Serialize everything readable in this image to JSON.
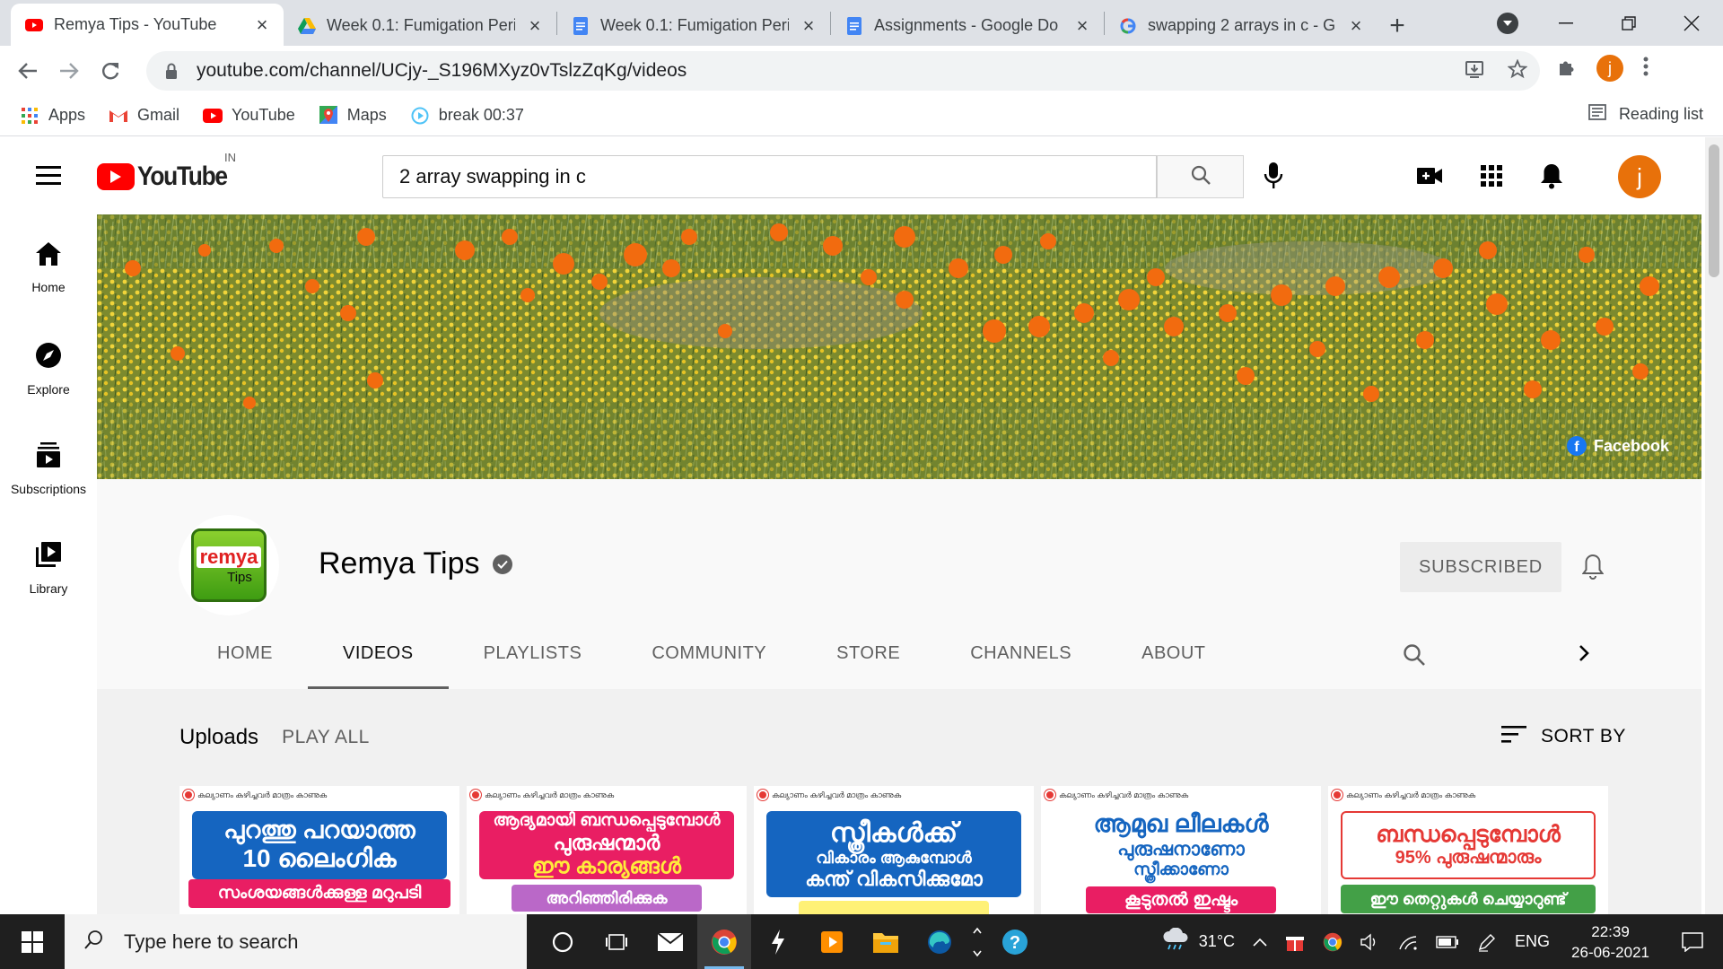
{
  "browser": {
    "tabs": [
      {
        "title": "Remya Tips - YouTube",
        "favicon": "youtube-icon",
        "active": true
      },
      {
        "title": "Week 0.1: Fumigation Peri",
        "favicon": "google-drive-icon",
        "active": false
      },
      {
        "title": "Week 0.1: Fumigation Peri",
        "favicon": "google-docs-icon",
        "active": false
      },
      {
        "title": "Assignments - Google Do",
        "favicon": "google-docs-icon",
        "active": false
      },
      {
        "title": "swapping 2 arrays in c - G",
        "favicon": "google-icon",
        "active": false
      }
    ],
    "url": "youtube.com/channel/UCjy-_S196MXyz0vTslzZqKg/videos",
    "profile_initial": "j",
    "bookmarks": [
      {
        "label": "Apps",
        "icon": "apps-grid-icon"
      },
      {
        "label": "Gmail",
        "icon": "gmail-icon"
      },
      {
        "label": "YouTube",
        "icon": "youtube-icon"
      },
      {
        "label": "Maps",
        "icon": "maps-icon"
      },
      {
        "label": "break 00:37",
        "icon": "timer-icon"
      }
    ],
    "reading_list": "Reading list"
  },
  "youtube": {
    "country_code": "IN",
    "search_query": "2 array swapping in c",
    "user_initial": "j",
    "guide": [
      {
        "label": "Home",
        "icon": "home-icon"
      },
      {
        "label": "Explore",
        "icon": "compass-icon"
      },
      {
        "label": "Subscriptions",
        "icon": "subscriptions-icon"
      },
      {
        "label": "Library",
        "icon": "library-icon"
      }
    ],
    "banner_link": "Facebook",
    "channel": {
      "name": "Remya Tips",
      "logo_line1": "remya",
      "logo_line2": "Tips",
      "subscribe_label": "SUBSCRIBED",
      "tabs": [
        "HOME",
        "VIDEOS",
        "PLAYLISTS",
        "COMMUNITY",
        "STORE",
        "CHANNELS",
        "ABOUT"
      ],
      "selected_tab": "VIDEOS"
    },
    "section": {
      "title": "Uploads",
      "play_all": "PLAY ALL",
      "sort_by": "SORT BY"
    },
    "videos": [
      {
        "caption": "കല്യാണം കഴിച്ചവർ മാത്രം കാണുക",
        "line1": "പുറത്തു പറയാത്ത",
        "line2": "10 ലൈംഗിക",
        "line3": "സംശയങ്ങൾക്കുള്ള മറുപടി",
        "line4": "",
        "color1": "#1565c0",
        "color2": "#e91e63",
        "color3": ""
      },
      {
        "caption": "കല്യാണം കഴിച്ചവർ മാത്രം കാണുക",
        "line1": "ആദ്യമായി ബന്ധപ്പെടുമ്പോൾ",
        "line2": "പുരുഷന്മാർ",
        "line3": "ഈ കാര്യങ്ങൾ",
        "line4": "അറിഞ്ഞിരിക്കുക",
        "color1": "#e91e63",
        "color2": "#e91e63",
        "color3": "#ba68c8"
      },
      {
        "caption": "കല്യാണം കഴിച്ചവർ മാത്രം കാണുക",
        "line1": "സ്ത്രീകൾക്ക്",
        "line2": "വികാരം ആകുമ്പോൾ",
        "line3": "കന്ത് വികസിക്കുമോ",
        "line4": "",
        "color1": "#1565c0",
        "color2": "#1565c0",
        "color3": "#fff176"
      },
      {
        "caption": "കല്യാണം കഴിച്ചവർ മാത്രം കാണുക",
        "line1": "ആമുഖ ലീലകൾ",
        "line2": "പുരുഷനാണോ",
        "line3": "സ്ത്രീക്കാണോ",
        "line4": "കൂടുതൽ ഇഷ്ടം",
        "color1": "#ffffff",
        "color2": "#e91e63",
        "color3": ""
      },
      {
        "caption": "കല്യാണം കഴിച്ചവർ മാത്രം കാണുക",
        "line1": "ബന്ധപ്പെടുമ്പോൾ",
        "line2": "95% പുരുഷന്മാരും",
        "line3": "ഈ തെറ്റുകൾ ചെയ്യാറുണ്ട്",
        "line4": "",
        "color1": "#ffffff",
        "color2": "#43a047",
        "color3": ""
      }
    ]
  },
  "taskbar": {
    "search_placeholder": "Type here to search",
    "weather": "31°C",
    "language": "ENG",
    "time": "22:39",
    "date": "26-06-2021"
  },
  "colors": {
    "youtube_red": "#ff0000",
    "avatar_orange": "#e8710a",
    "taskbar": "#1f1f1f"
  }
}
